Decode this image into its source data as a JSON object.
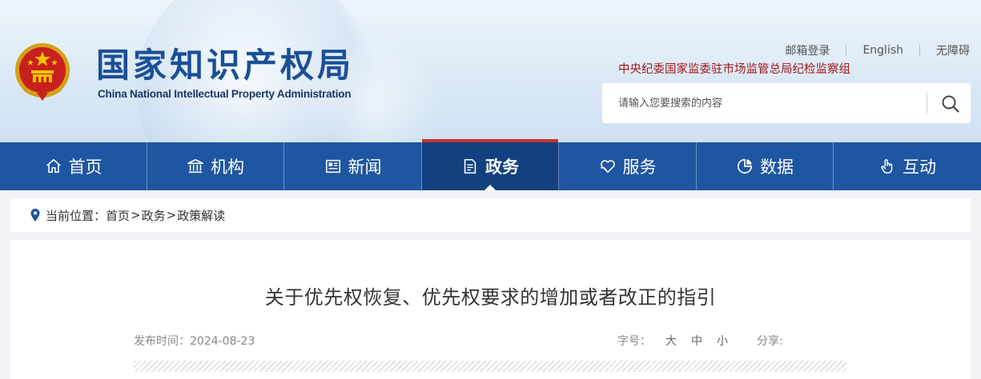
{
  "header": {
    "site_title": "国家知识产权局",
    "site_subtitle": "China National Intellectual Property Administration",
    "top_links": [
      "邮箱登录",
      "English",
      "无障碍"
    ],
    "inspection_link": "中央纪委国家监委驻市场监管总局纪检监察组",
    "search": {
      "placeholder": "请输入您要搜索的内容"
    }
  },
  "nav": {
    "items": [
      {
        "label": "首页",
        "icon": "home-icon"
      },
      {
        "label": "机构",
        "icon": "institution-icon"
      },
      {
        "label": "新闻",
        "icon": "news-icon"
      },
      {
        "label": "政务",
        "icon": "document-icon",
        "active": true
      },
      {
        "label": "服务",
        "icon": "service-icon"
      },
      {
        "label": "数据",
        "icon": "pie-chart-icon"
      },
      {
        "label": "互动",
        "icon": "hand-pointer-icon"
      }
    ]
  },
  "breadcrumb": {
    "prefix": "当前位置：",
    "items": [
      "首页",
      "政务",
      "政策解读"
    ],
    "separator": ">"
  },
  "article": {
    "title": "关于优先权恢复、优先权要求的增加或者改正的指引",
    "date_label": "发布时间：",
    "date": "2024-08-23",
    "font_size_label": "字号：",
    "font_sizes": [
      "大",
      "中",
      "小"
    ],
    "share_label": "分享:"
  },
  "colors": {
    "nav_background": "#1f56a2",
    "nav_active": "#13417f",
    "accent_red": "#c9332e",
    "title_blue": "#1a4f98"
  }
}
